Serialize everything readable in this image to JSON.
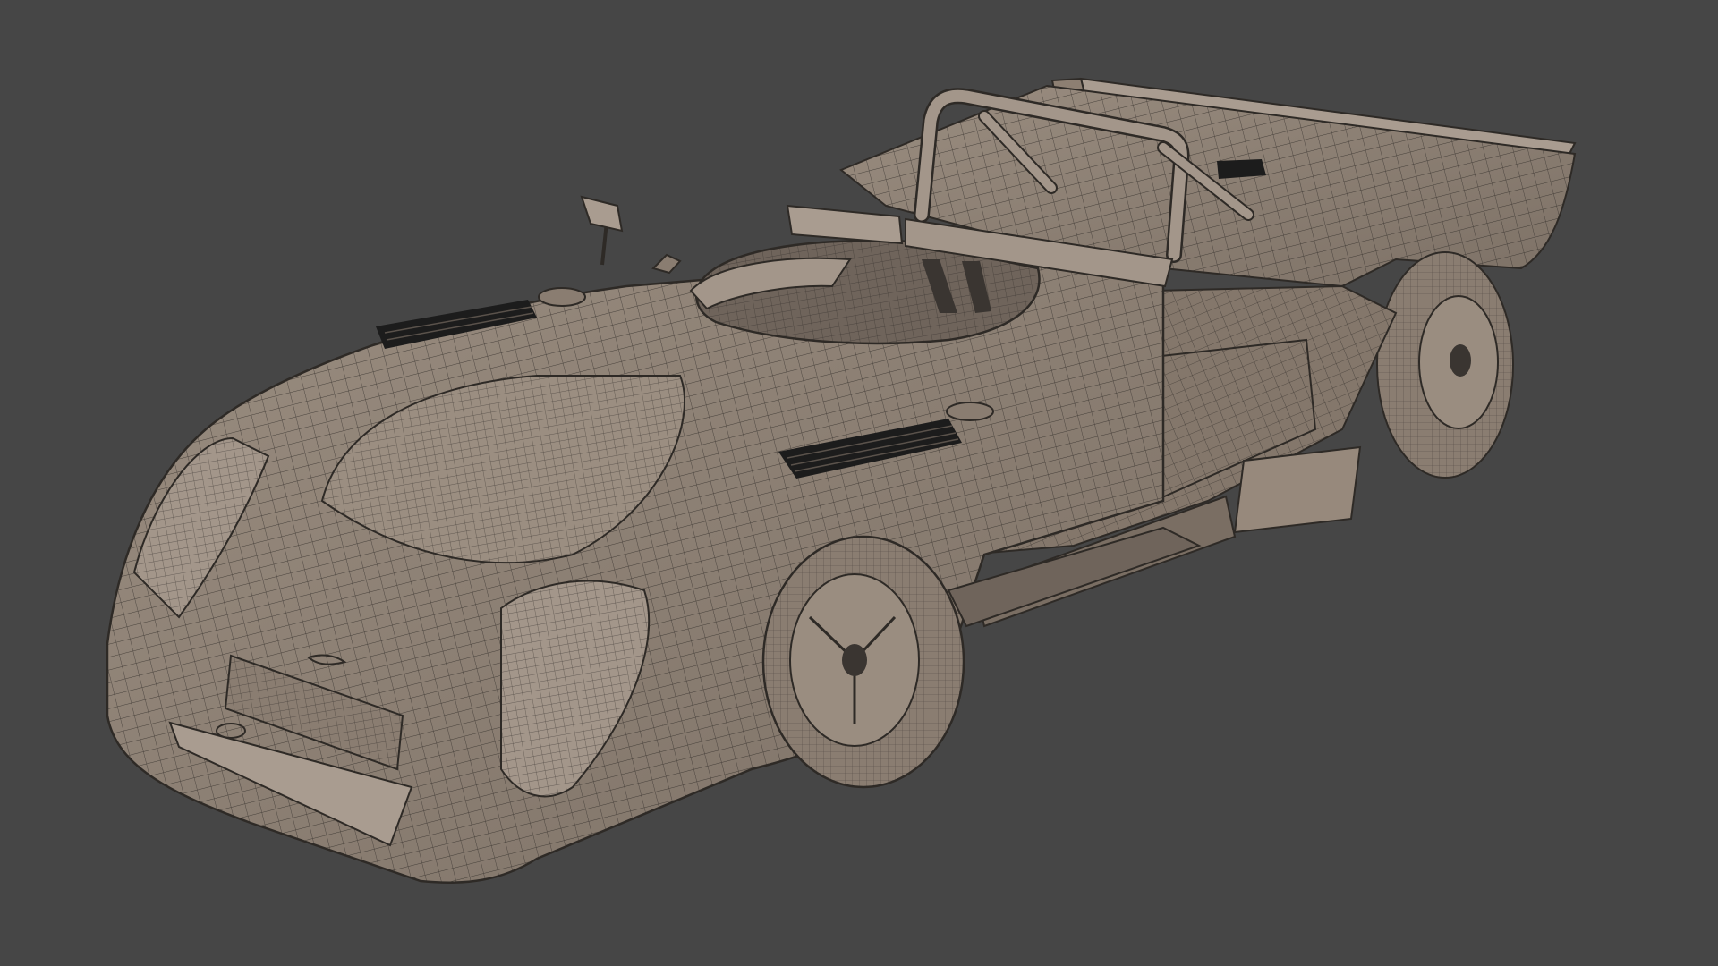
{
  "viewport": {
    "background_color": "#464646",
    "shading": "wireframe-on-shaded",
    "wire_color": "#2e2a26",
    "surface_color": "#8d7f72",
    "surface_light_color": "#a3968a",
    "surface_dark_color": "#6f645b",
    "vent_color": "#1c1c1c"
  },
  "model": {
    "subject": "open-cockpit-race-car",
    "icon": "car-wireframe-icon"
  }
}
